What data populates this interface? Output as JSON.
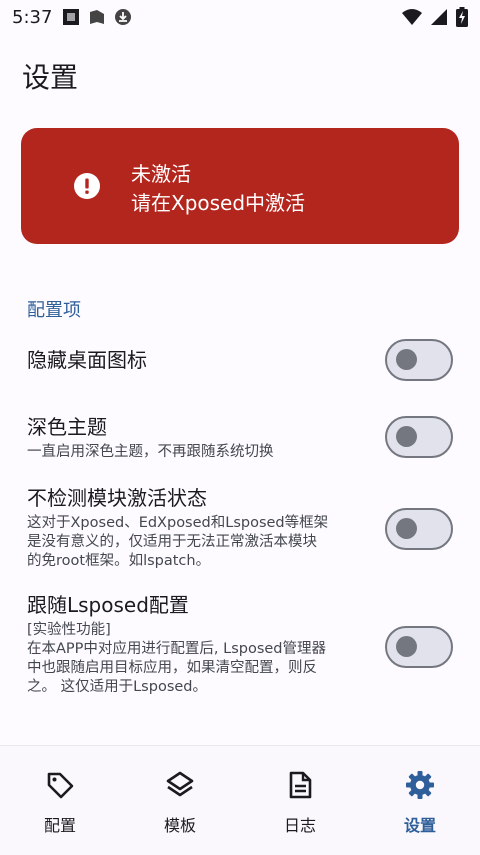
{
  "status_bar": {
    "time": "5:37"
  },
  "page": {
    "title": "设置"
  },
  "alert": {
    "line1": "未激活",
    "line2": "请在Xposed中激活",
    "color": "#b3261e"
  },
  "section": {
    "label": "配置项"
  },
  "settings": [
    {
      "title": "隐藏桌面图标",
      "subtitle": "",
      "enabled": false
    },
    {
      "title": "深色主题",
      "subtitle": "一直启用深色主题，不再跟随系统切换",
      "enabled": false
    },
    {
      "title": "不检测模块激活状态",
      "subtitle_lines": [
        "这对于Xposed、EdXposed和Lsposed等框架",
        "是没有意义的，仅适用于无法正常激活本模块",
        "的免root框架。如lspatch。"
      ],
      "enabled": false
    },
    {
      "title": "跟随Lsposed配置",
      "subtitle_lines": [
        "[实验性功能]",
        "在本APP中对应用进行配置后, Lsposed管理器",
        "中也跟随启用目标应用，如果清空配置，则反",
        "之。 这仅适用于Lsposed。"
      ],
      "enabled": false
    }
  ],
  "nav": {
    "items": [
      {
        "label": "配置",
        "icon": "tag-icon",
        "active": false
      },
      {
        "label": "模板",
        "icon": "layers-icon",
        "active": false
      },
      {
        "label": "日志",
        "icon": "document-icon",
        "active": false
      },
      {
        "label": "设置",
        "icon": "gear-icon",
        "active": true
      }
    ],
    "accent": "#2f5f9a"
  }
}
